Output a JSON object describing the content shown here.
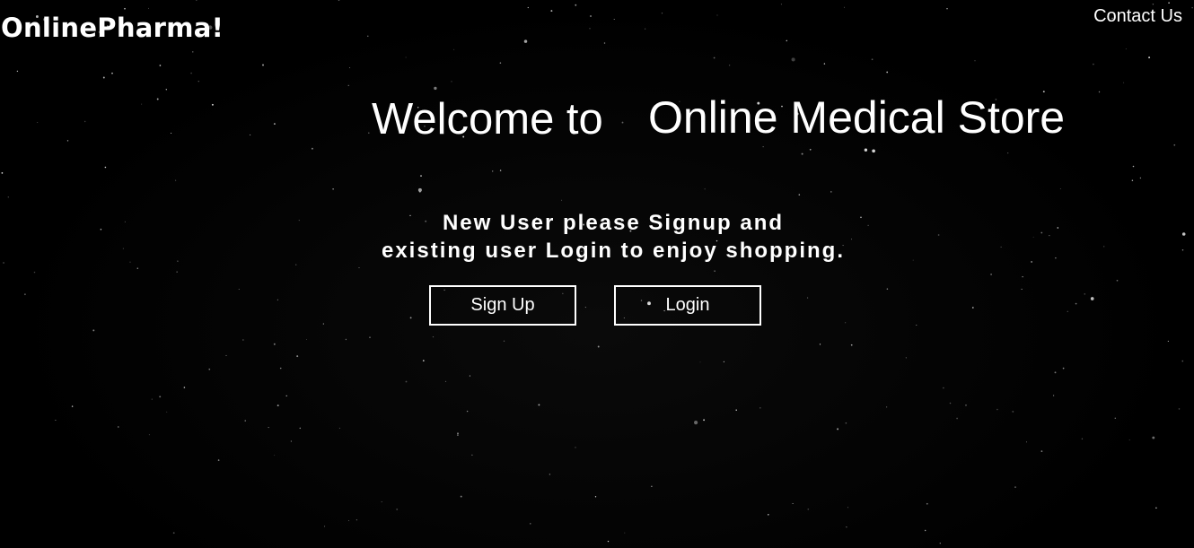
{
  "header": {
    "brand": "OnlinePharma!",
    "contact_link": "Contact Us"
  },
  "hero": {
    "welcome_text": "Welcome to",
    "store_name": "Online Medical Store",
    "tagline_line1": "New User please Signup and",
    "tagline_line2": "existing user Login to enjoy shopping."
  },
  "actions": {
    "signup_label": "Sign Up",
    "login_label": "Login"
  },
  "theme": {
    "background": "#000000",
    "text": "#ffffff",
    "button_border": "#ffffff"
  }
}
